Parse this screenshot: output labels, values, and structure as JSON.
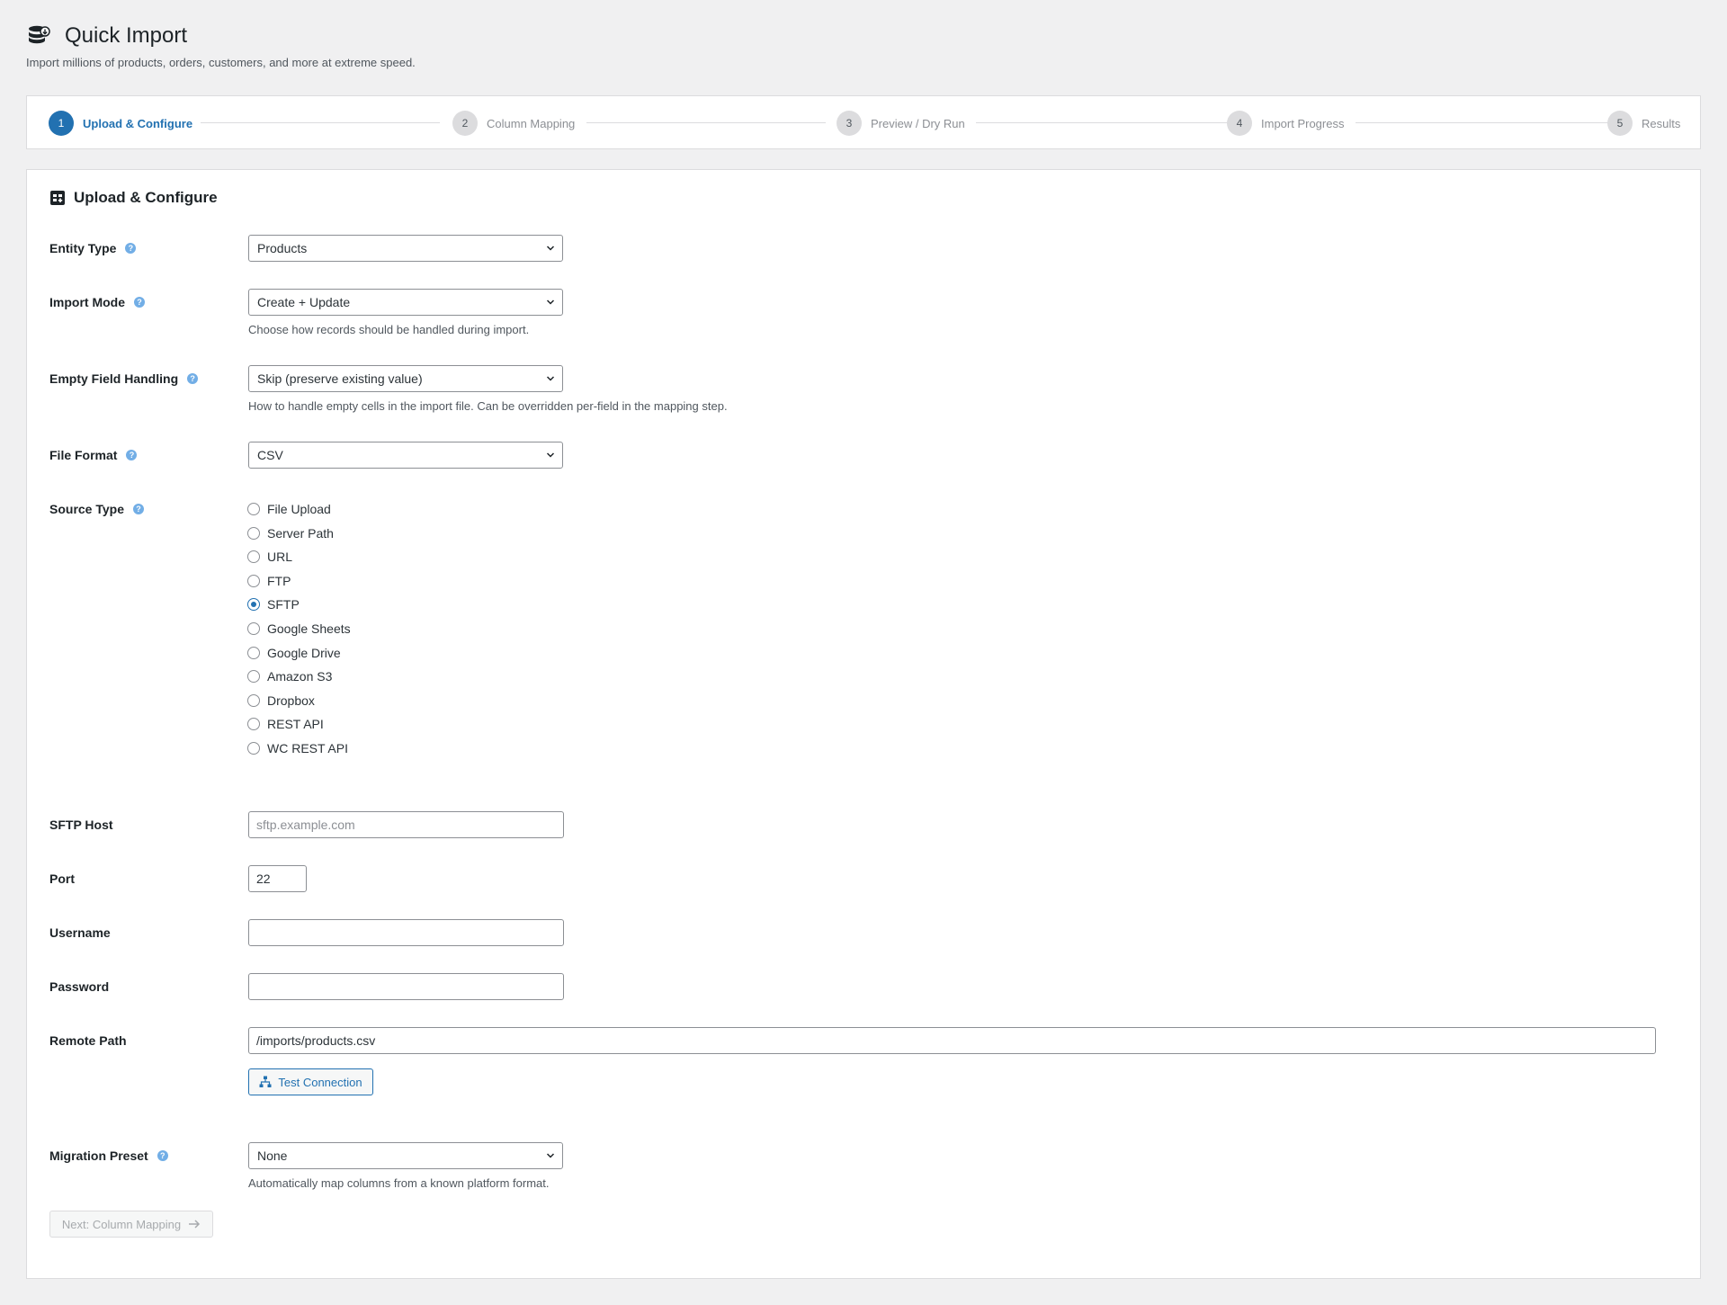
{
  "header": {
    "title": "Quick Import",
    "subtitle": "Import millions of products, orders, customers, and more at extreme speed."
  },
  "steps": [
    {
      "num": "1",
      "label": "Upload & Configure",
      "active": true
    },
    {
      "num": "2",
      "label": "Column Mapping"
    },
    {
      "num": "3",
      "label": "Preview / Dry Run"
    },
    {
      "num": "4",
      "label": "Import Progress"
    },
    {
      "num": "5",
      "label": "Results"
    }
  ],
  "card": {
    "title": "Upload & Configure"
  },
  "form": {
    "entity_type": {
      "label": "Entity Type",
      "value": "Products"
    },
    "import_mode": {
      "label": "Import Mode",
      "value": "Create + Update",
      "desc": "Choose how records should be handled during import."
    },
    "empty_field": {
      "label": "Empty Field Handling",
      "value": "Skip (preserve existing value)",
      "desc": "How to handle empty cells in the import file. Can be overridden per-field in the mapping step."
    },
    "file_format": {
      "label": "File Format",
      "value": "CSV"
    },
    "source_type": {
      "label": "Source Type",
      "selected": "SFTP",
      "options": [
        "File Upload",
        "Server Path",
        "URL",
        "FTP",
        "SFTP",
        "Google Sheets",
        "Google Drive",
        "Amazon S3",
        "Dropbox",
        "REST API",
        "WC REST API"
      ]
    },
    "sftp_host": {
      "label": "SFTP Host",
      "placeholder": "sftp.example.com",
      "value": ""
    },
    "port": {
      "label": "Port",
      "value": "22"
    },
    "username": {
      "label": "Username",
      "value": ""
    },
    "password": {
      "label": "Password",
      "value": ""
    },
    "remote_path": {
      "label": "Remote Path",
      "value": "/imports/products.csv"
    },
    "test_connection_label": "Test Connection",
    "migration_preset": {
      "label": "Migration Preset",
      "value": "None",
      "desc": "Automatically map columns from a known platform format."
    },
    "next_label": "Next: Column Mapping"
  },
  "help_glyph": "?",
  "colors": {
    "accent": "#2271b1",
    "help": "#72aee6",
    "border": "#8c8f94"
  }
}
